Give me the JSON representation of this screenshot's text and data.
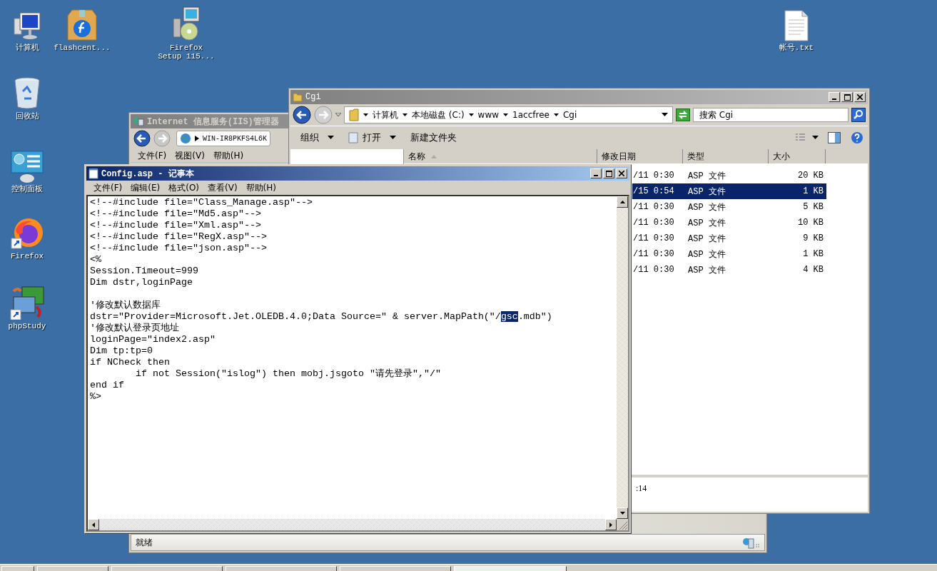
{
  "desktop_icons": [
    {
      "kind": "computer",
      "label": "计算机"
    },
    {
      "kind": "package",
      "label": "flashcent..."
    },
    {
      "kind": "installer",
      "label": "Firefox\nSetup 115..."
    },
    {
      "kind": "text-file",
      "label": "帐号.txt"
    },
    {
      "kind": "recycle-bin",
      "label": "回收站"
    },
    {
      "kind": "control-panel",
      "label": "控制面板"
    },
    {
      "kind": "firefox",
      "label": "Firefox"
    },
    {
      "kind": "phpstudy",
      "label": "phpStudy"
    }
  ],
  "iis_window": {
    "title": "Internet 信息服务(IIS)管理器",
    "address": "WIN-IR8PKFS4L6K",
    "menu": [
      "文件(F)",
      "视图(V)",
      "帮助(H)"
    ],
    "status": "就绪"
  },
  "explorer_window": {
    "title": "Cgi",
    "breadcrumb": [
      "计算机",
      "本地磁盘 (C:)",
      "www",
      "1accfree",
      "Cgi"
    ],
    "search": {
      "placeholder": "搜索 Cgi"
    },
    "toolbar": [
      {
        "kind": "dropdown",
        "label": "组织"
      },
      {
        "kind": "open",
        "label": "打开"
      },
      {
        "kind": "plain",
        "label": "新建文件夹"
      }
    ],
    "columns": [
      {
        "label": "名称",
        "sorted": true
      },
      {
        "label": "修改日期",
        "sorted": false
      },
      {
        "label": "类型",
        "sorted": false
      },
      {
        "label": "大小",
        "sorted": false
      }
    ],
    "rows": [
      {
        "date": "/11 0:30",
        "type": "ASP 文件",
        "size": "20 KB",
        "selected": false
      },
      {
        "date": "/15 0:54",
        "type": "ASP 文件",
        "size": "1 KB",
        "selected": true
      },
      {
        "date": "/11 0:30",
        "type": "ASP 文件",
        "size": "5 KB",
        "selected": false
      },
      {
        "date": "/11 0:30",
        "type": "ASP 文件",
        "size": "10 KB",
        "selected": false
      },
      {
        "date": "/11 0:30",
        "type": "ASP 文件",
        "size": "9 KB",
        "selected": false
      },
      {
        "date": "/11 0:30",
        "type": "ASP 文件",
        "size": "1 KB",
        "selected": false
      },
      {
        "date": "/11 0:30",
        "type": "ASP 文件",
        "size": "4 KB",
        "selected": false
      }
    ],
    "details": ":14"
  },
  "notepad_window": {
    "title": "Config.asp - 记事本",
    "menu": [
      "文件(F)",
      "编辑(E)",
      "格式(O)",
      "查看(V)",
      "帮助(H)"
    ],
    "lines": [
      {
        "kind": "text",
        "text": "<!--#include file=\"Class_Manage.asp\"-->"
      },
      {
        "kind": "text",
        "text": "<!--#include file=\"Md5.asp\"-->"
      },
      {
        "kind": "text",
        "text": "<!--#include file=\"Xml.asp\"-->"
      },
      {
        "kind": "text",
        "text": "<!--#include file=\"RegX.asp\"-->"
      },
      {
        "kind": "text",
        "text": "<!--#include file=\"json.asp\"-->"
      },
      {
        "kind": "text",
        "text": "<%"
      },
      {
        "kind": "text",
        "text": "Session.Timeout=999"
      },
      {
        "kind": "text",
        "text": "Dim dstr,loginPage"
      },
      {
        "kind": "blank"
      },
      {
        "kind": "text",
        "text": "'修改默认数据库"
      },
      {
        "kind": "segments",
        "segments": [
          {
            "text": "dstr=\"Provider=Microsoft.Jet.OLEDB.4.0;Data Source=\" & server.MapPath(\"/",
            "selected": false
          },
          {
            "text": "gsc",
            "selected": true
          },
          {
            "text": ".mdb\")",
            "selected": false
          }
        ]
      },
      {
        "kind": "text",
        "text": "'修改默认登录页地址"
      },
      {
        "kind": "text",
        "text": "loginPage=\"index2.asp\""
      },
      {
        "kind": "text",
        "text": "Dim tp:tp=0"
      },
      {
        "kind": "text",
        "text": "if NCheck then"
      },
      {
        "kind": "text",
        "text": "\tif not Session(\"islog\") then mobj.jsgoto \"请先登录\",\"/\""
      },
      {
        "kind": "text",
        "text": "end if"
      },
      {
        "kind": "text",
        "text": "%>"
      }
    ]
  }
}
